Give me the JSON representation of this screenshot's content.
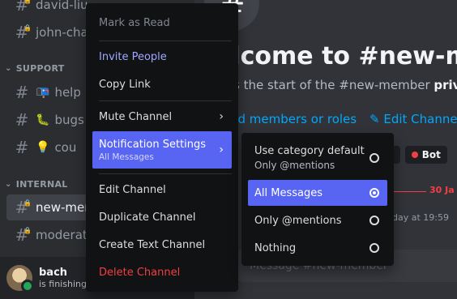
{
  "sidebar": {
    "channels": [
      {
        "name": "david-liu",
        "emoji": ""
      },
      {
        "name": "john-cha",
        "emoji": ""
      },
      {
        "name": "help",
        "emoji": "📭"
      },
      {
        "name": "bugs",
        "emoji": "🐛"
      },
      {
        "name": "cou",
        "emoji": "💡"
      },
      {
        "name": "new-mem",
        "emoji": ""
      },
      {
        "name": "moderato",
        "emoji": ""
      }
    ],
    "categories": {
      "support": "SUPPORT",
      "internal": "INTERNAL"
    }
  },
  "user": {
    "name": "bach",
    "status": "is finishing"
  },
  "main": {
    "icon_glyph": "#",
    "welcome": "elcome to #new-me",
    "start_prefix": "s the start of the #new-member ",
    "start_bold": "private",
    "add_members": "dd members or roles",
    "edit_channel": "Edit Channel",
    "tag_t": "t",
    "tag_bot": "Bot",
    "date": "30 Ja",
    "timestamp": "day at 19:59",
    "composer_placeholder": "Message #new-member"
  },
  "context_menu": {
    "mark_read": "Mark as Read",
    "invite": "Invite People",
    "copy_link": "Copy Link",
    "mute": "Mute Channel",
    "notifications": "Notification Settings",
    "notifications_sub": "All Messages",
    "edit": "Edit Channel",
    "duplicate": "Duplicate Channel",
    "create_text": "Create Text Channel",
    "delete": "Delete Channel"
  },
  "submenu": {
    "use_default": "Use category default",
    "use_default_sub": "Only @mentions",
    "all": "All Messages",
    "mentions": "Only @mentions",
    "nothing": "Nothing",
    "selected": "All Messages"
  },
  "colors": {
    "accent": "#5865f2",
    "danger": "#f23f43",
    "link": "#00a8fc"
  }
}
